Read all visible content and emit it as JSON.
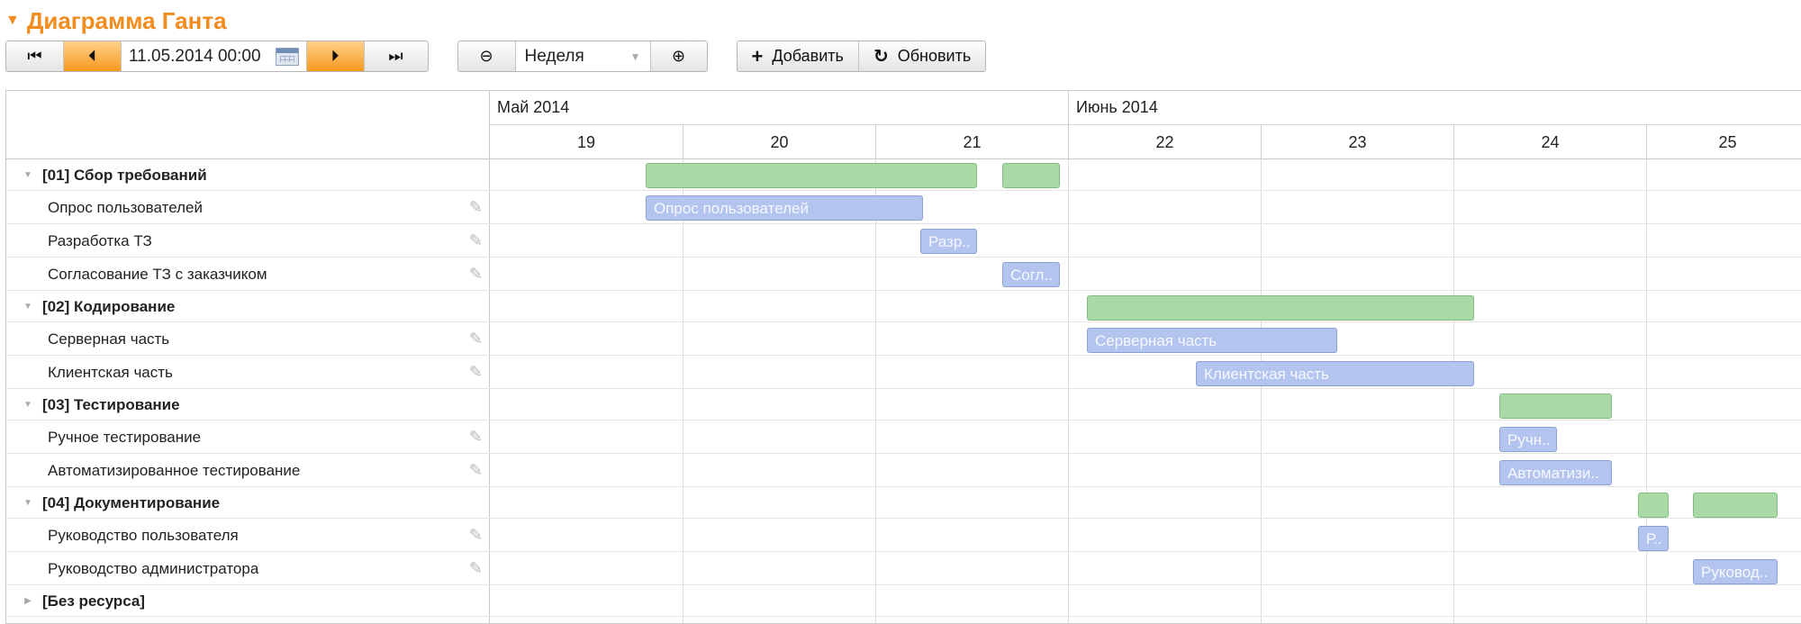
{
  "title": "Диаграмма Ганта",
  "toolbar": {
    "date": "11.05.2014 00:00",
    "scale": "Неделя",
    "add_label": "Добавить",
    "refresh_label": "Обновить"
  },
  "timeline": {
    "months": [
      "Май 2014",
      "Июнь 2014"
    ],
    "weeks": [
      "19",
      "20",
      "21",
      "22",
      "23",
      "24",
      "25"
    ]
  },
  "rows": [
    {
      "label": "[01] Сбор требований",
      "type": "group"
    },
    {
      "label": "Опрос пользователей",
      "type": "task"
    },
    {
      "label": "Разработка ТЗ",
      "type": "task"
    },
    {
      "label": "Согласование ТЗ с заказчиком",
      "type": "task"
    },
    {
      "label": "[02] Кодирование",
      "type": "group"
    },
    {
      "label": "Серверная часть",
      "type": "task"
    },
    {
      "label": "Клиентская часть",
      "type": "task"
    },
    {
      "label": "[03] Тестирование",
      "type": "group"
    },
    {
      "label": "Ручное тестирование",
      "type": "task"
    },
    {
      "label": "Автоматизированное тестирование",
      "type": "task"
    },
    {
      "label": "[04] Документирование",
      "type": "group"
    },
    {
      "label": "Руководство пользователя",
      "type": "task"
    },
    {
      "label": "Руководство администратора",
      "type": "task"
    },
    {
      "label": "[Без ресурса]",
      "type": "group-collapsed"
    }
  ],
  "bars": {
    "b1": "Опрос пользователей",
    "b2": "Разр..",
    "b3": "Согл..",
    "b4": "Серверная часть",
    "b5": "Клиентская часть",
    "b6": "Ручн..",
    "b7": "Автоматизи..",
    "b8": "Р..",
    "b9": "Руковод.."
  },
  "colors": {
    "accent": "#f28c1e",
    "summary_bar": "#a8d9a6",
    "task_bar": "#b3c4ef"
  }
}
